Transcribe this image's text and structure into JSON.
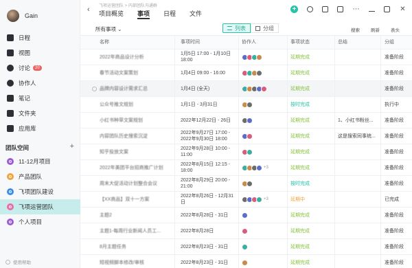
{
  "user": {
    "name": "Gain"
  },
  "nav": [
    {
      "label": "日程",
      "icon": "calendar-icon"
    },
    {
      "label": "视图",
      "icon": "view-icon"
    },
    {
      "label": "讨论",
      "icon": "chat-icon",
      "badge": "20"
    },
    {
      "label": "协作人",
      "icon": "person-icon"
    },
    {
      "label": "笔记",
      "icon": "note-icon"
    },
    {
      "label": "文件夹",
      "icon": "folder-icon"
    },
    {
      "label": "应用库",
      "icon": "apps-icon"
    }
  ],
  "team_space": {
    "title": "团队空间",
    "add": "+"
  },
  "projects": [
    {
      "label": "11-12月项目",
      "color": "#9c5bd6"
    },
    {
      "label": "产品团队",
      "color": "#f2a33a"
    },
    {
      "label": "飞项团队建设",
      "color": "#3a8de8"
    },
    {
      "label": "飞项运营团队",
      "color": "#ef6aa5",
      "active": true
    },
    {
      "label": "个人项目",
      "color": "#9c5bd6"
    }
  ],
  "help": "使用帮助",
  "header": {
    "breadcrumb": "飞项运营团队 > 内部团队沟通群",
    "tabs": [
      "项目概览",
      "事项",
      "日程",
      "文件"
    ],
    "active_tab": 1
  },
  "toolbar": {
    "filter": "所有事项 ⌄",
    "view_list": "列表",
    "view_group": "分组",
    "search": "搜索",
    "refresh": "刷新",
    "header_cfg": "表头"
  },
  "columns": [
    "名称",
    "事项时间",
    "协作人",
    "事项状态",
    "总结",
    "分组"
  ],
  "status_colors": {
    "延期完成": "#86c23d",
    "按时完成": "#23c4a8",
    "延期中": "#f2a33a"
  },
  "rows": [
    {
      "name": "2022年商品设计分析",
      "time": "1月5日 17:00 - 1月10日 18:00",
      "avatars": 4,
      "more": "",
      "status": "延期完成",
      "summary": "",
      "group": "准备阶段"
    },
    {
      "name": "春节活动文案策划",
      "time": "1月4日 09:00 - 16:00",
      "avatars": 4,
      "more": "",
      "status": "延期完成",
      "summary": "",
      "group": "准备阶段"
    },
    {
      "name": "品牌内容设计需求汇总",
      "time": "1月4日 (全天)",
      "avatars": 5,
      "more": "",
      "status": "延期完成",
      "summary": "",
      "group": "准备阶段"
    },
    {
      "name": "公众号推文规划",
      "time": "1月1日 - 3月31日",
      "avatars": 2,
      "more": "",
      "status": "按时完成",
      "summary": "",
      "group": "执行中"
    },
    {
      "name": "小红书种草文案规划",
      "time": "2022年12月22日 - 26日",
      "avatars": 2,
      "more": "",
      "status": "延期完成",
      "summary": "1、小红书粉丝...",
      "group": "准备阶段"
    },
    {
      "name": "内容团队历史搜索沉淀",
      "time": "2022年9月27日 17:00 - 2022年9月30日 18:00",
      "avatars": 2,
      "more": "",
      "status": "延期完成",
      "summary": "这是搜索同事统...",
      "group": "准备阶段"
    },
    {
      "name": "知乎投放文案",
      "time": "2022年9月28日 10:00 - 11:00",
      "avatars": 2,
      "more": "",
      "status": "延期完成",
      "summary": "",
      "group": "准备阶段"
    },
    {
      "name": "2022年美团平台招商推广计划",
      "time": "2022年8月15日 12:15 - 18:00",
      "avatars": 4,
      "more": "+3",
      "status": "延期完成",
      "summary": "",
      "group": "准备阶段"
    },
    {
      "name": "周末大促活动计划整合会议",
      "time": "2022年8月29日 20:00 - 21:00",
      "avatars": 2,
      "more": "",
      "status": "按时完成",
      "summary": "",
      "group": "准备阶段"
    },
    {
      "name": "【XX商品】双十一方案",
      "time": "2022年8月26日 - 12月31日",
      "avatars": 4,
      "more": "+3",
      "status": "延期中",
      "summary": "",
      "group": "已完成"
    },
    {
      "name": "主题2",
      "time": "2022年8月28日 - 31日",
      "avatars": 1,
      "more": "",
      "status": "延期完成",
      "summary": "",
      "group": "准备阶段"
    },
    {
      "name": "主题1-每周行业新闻人员工...",
      "time": "2022年8月28日",
      "avatars": 1,
      "more": "",
      "status": "延期完成",
      "summary": "",
      "group": "准备阶段"
    },
    {
      "name": "8月主题任务",
      "time": "2022年8月23日 - 31日",
      "avatars": 1,
      "more": "",
      "status": "延期完成",
      "summary": "",
      "group": "准备阶段"
    },
    {
      "name": "短视频脚本修改/审核",
      "time": "2022年8月23日 - 31日",
      "avatars": 1,
      "more": "",
      "status": "延期完成",
      "summary": "",
      "group": "准备阶段"
    }
  ]
}
